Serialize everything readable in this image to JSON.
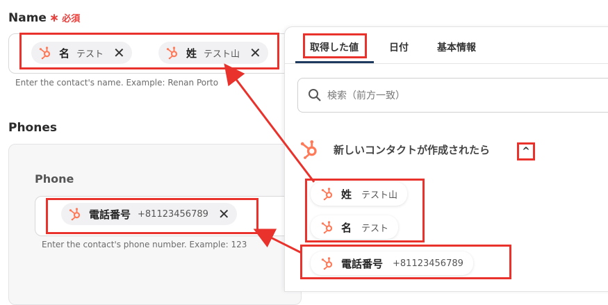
{
  "form": {
    "name_field": {
      "label": "Name",
      "required_star": "∗",
      "required_text": "必須",
      "chips": [
        {
          "name": "名",
          "value": "テスト"
        },
        {
          "name": "姓",
          "value": "テスト山"
        }
      ],
      "help": "Enter the contact's name. Example: Renan Porto"
    },
    "phones_section": {
      "title": "Phones",
      "phone_label": "Phone",
      "chip": {
        "name": "電話番号",
        "value": "+81123456789"
      },
      "help": "Enter the contact's phone number. Example: 123"
    }
  },
  "panel": {
    "tabs": [
      "取得した値",
      "日付",
      "基本情報"
    ],
    "search_placeholder": "検索（前方一致）",
    "trigger_title": "新しいコンタクトが作成されたら",
    "caret": "^",
    "outputs": [
      {
        "name": "姓",
        "value": "テスト山"
      },
      {
        "name": "名",
        "value": "テスト"
      },
      {
        "name": "電話番号",
        "value": "+81123456789"
      }
    ]
  },
  "colors": {
    "accent_red": "#e8322b",
    "hubspot_orange": "#ff7a59",
    "tab_underline": "#1f3a5f"
  },
  "icons": [
    "hubspot-icon",
    "close-icon",
    "search-icon",
    "chevron-up-icon"
  ]
}
